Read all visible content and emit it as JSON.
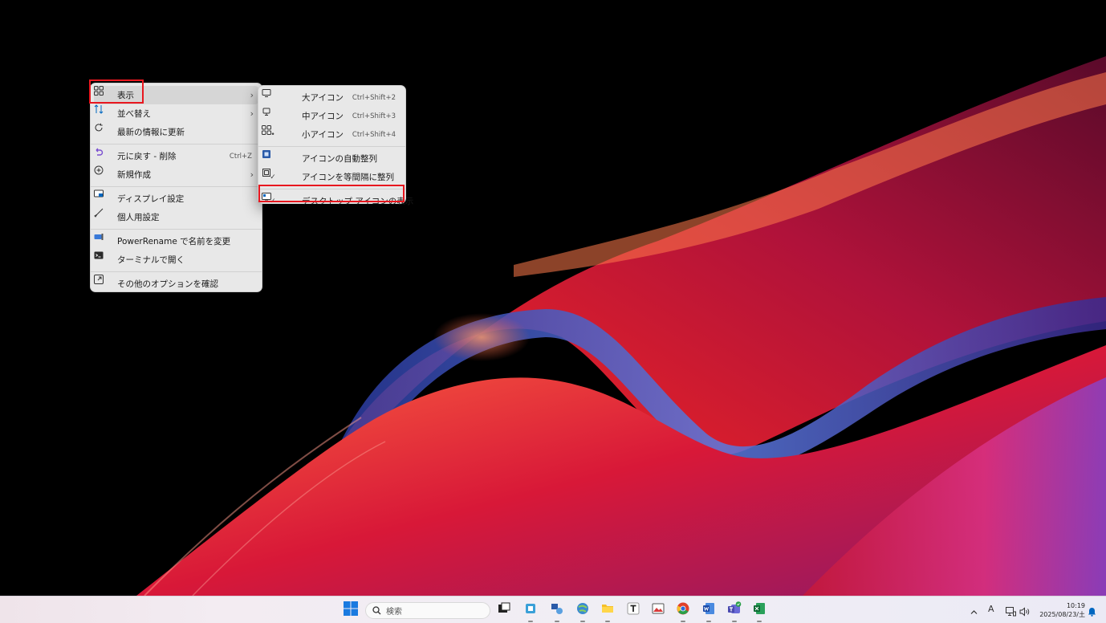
{
  "main_menu": {
    "items": [
      {
        "label": "表示",
        "shortcut": "",
        "icon": "grid-icon"
      },
      {
        "label": "並べ替え",
        "shortcut": "",
        "icon": "sort-icon"
      },
      {
        "label": "最新の情報に更新",
        "shortcut": "",
        "icon": "refresh-icon"
      },
      {
        "label": "元に戻す - 削除",
        "shortcut": "Ctrl+Z",
        "icon": "undo-icon"
      },
      {
        "label": "新規作成",
        "shortcut": "",
        "icon": "new-icon"
      },
      {
        "label": "ディスプレイ設定",
        "shortcut": "",
        "icon": "display-icon"
      },
      {
        "label": "個人用設定",
        "shortcut": "",
        "icon": "brush-icon"
      },
      {
        "label": "PowerRename で名前を変更",
        "shortcut": "",
        "icon": "powerrename-icon"
      },
      {
        "label": "ターミナルで開く",
        "shortcut": "",
        "icon": "terminal-icon"
      },
      {
        "label": "その他のオプションを確認",
        "shortcut": "",
        "icon": "more-options-icon"
      }
    ],
    "submenu_arrow": "›"
  },
  "view_submenu": {
    "items": [
      {
        "label": "大アイコン",
        "shortcut": "Ctrl+Shift+2",
        "mark": ""
      },
      {
        "label": "中アイコン",
        "shortcut": "Ctrl+Shift+3",
        "mark": ""
      },
      {
        "label": "小アイコン",
        "shortcut": "Ctrl+Shift+4",
        "mark": "•"
      },
      {
        "label": "アイコンの自動整列",
        "shortcut": "",
        "mark": ""
      },
      {
        "label": "アイコンを等間隔に整列",
        "shortcut": "",
        "mark": "✓"
      },
      {
        "label": "デスクトップ アイコンの表示",
        "shortcut": "",
        "mark": "✓"
      }
    ]
  },
  "taskbar": {
    "search_placeholder": "検索",
    "ime_indicator": "A",
    "clock_time": "10:19",
    "clock_date": "2025/08/23/土",
    "accent": "#0067c0"
  },
  "colors": {
    "highlight_box": "#e8171f",
    "menu_bg": "#e8e8e8"
  }
}
